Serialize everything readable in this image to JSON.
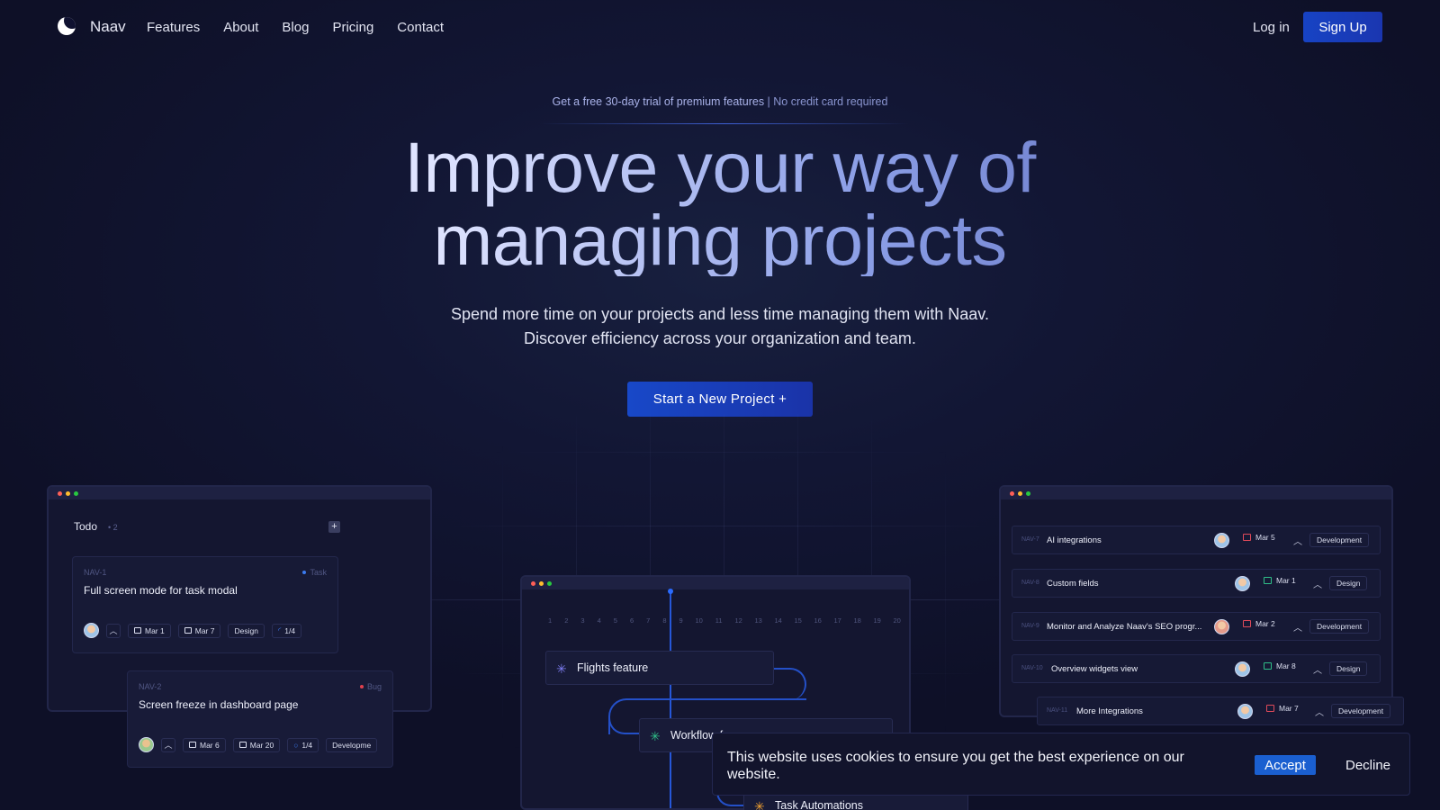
{
  "nav": {
    "brand": "Naav",
    "links": [
      "Features",
      "About",
      "Blog",
      "Pricing",
      "Contact"
    ],
    "login": "Log in",
    "signup": "Sign Up"
  },
  "hero": {
    "promo_main": "Get a free 30-day trial of premium features",
    "promo_sep": " | ",
    "promo_tail": "No credit card required",
    "headline_line1": "Improve your way of",
    "headline_line2": "managing projects",
    "sub_line1": "Spend more time on your projects and less time managing them with Naav.",
    "sub_line2": "Discover efficiency across your organization and team.",
    "cta": "Start a New Project +"
  },
  "todo": {
    "title": "Todo",
    "count": "• 2",
    "add": "+",
    "cards": [
      {
        "id": "NAV-1",
        "type": "Task",
        "type_color": "#3b7bf0",
        "title": "Full screen mode for task modal",
        "start": "Mar 1",
        "end": "Mar 7",
        "tag": "Design",
        "progress": "1/4"
      },
      {
        "id": "NAV-2",
        "type": "Bug",
        "type_color": "#e0404e",
        "title": "Screen freeze in dashboard page",
        "start": "Mar 6",
        "end": "Mar 20",
        "progress": "1/4",
        "tag": "Developme"
      }
    ]
  },
  "timeline": {
    "days": [
      "1",
      "2",
      "3",
      "4",
      "5",
      "6",
      "7",
      "8",
      "9",
      "10",
      "11",
      "12",
      "13",
      "14",
      "15",
      "16",
      "17",
      "18",
      "19",
      "20"
    ],
    "tasks": [
      {
        "label": "Flights feature",
        "icon_color": "#7c7cf0"
      },
      {
        "label": "Workflow f",
        "icon_color": "#2fbf88"
      },
      {
        "label": "Task Automations",
        "icon_color": "#f0a030"
      }
    ]
  },
  "list": {
    "rows": [
      {
        "id": "NAV-7",
        "title": "AI integrations",
        "date": "Mar 5",
        "date_icon": "red",
        "tag": "Development"
      },
      {
        "id": "NAV-8",
        "title": "Custom fields",
        "date": "Mar 1",
        "date_icon": "green",
        "tag": "Design"
      },
      {
        "id": "NAV-9",
        "title": "Monitor and Analyze Naav's SEO progr...",
        "date": "Mar 2",
        "date_icon": "red",
        "tag": "Development"
      },
      {
        "id": "NAV-10",
        "title": "Overview widgets view",
        "date": "Mar 8",
        "date_icon": "green",
        "tag": "Design"
      },
      {
        "id": "NAV-11",
        "title": "More Integrations",
        "date": "Mar 7",
        "date_icon": "red",
        "tag": "Development"
      }
    ]
  },
  "cookie": {
    "text": "This website uses cookies to ensure you get the best experience on our website.",
    "accept": "Accept",
    "decline": "Decline"
  },
  "colors": {
    "background": "#0f1029",
    "accent": "#1a4fd0",
    "headline_gradient_start": "#dfe4ff",
    "headline_gradient_end": "#6b7bc9"
  }
}
